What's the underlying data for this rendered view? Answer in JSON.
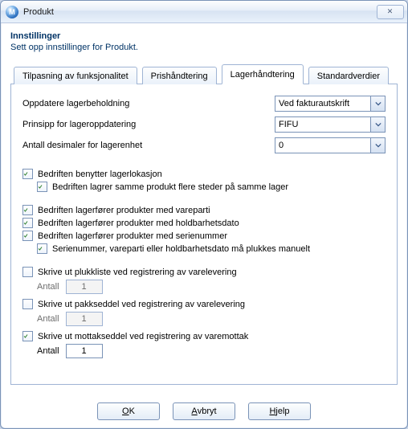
{
  "window": {
    "title": "Produkt",
    "app_icon_letter": "M",
    "close_glyph": "✕"
  },
  "header": {
    "title": "Innstillinger",
    "subtitle": "Sett opp innstillinger for Produkt."
  },
  "tabs": {
    "items": [
      {
        "label": "Tilpasning av funksjonalitet"
      },
      {
        "label": "Prishåndtering"
      },
      {
        "label": "Lagerhåndtering"
      },
      {
        "label": "Standardverdier"
      }
    ],
    "active_index": 2
  },
  "form": {
    "row1": {
      "label": "Oppdatere lagerbeholdning",
      "value": "Ved fakturautskrift"
    },
    "row2": {
      "label": "Prinsipp for lageroppdatering",
      "value": "FIFU"
    },
    "row3": {
      "label": "Antall desimaler for lagerenhet",
      "value": "0"
    }
  },
  "checks": {
    "c1": {
      "label": "Bedriften benytter lagerlokasjon"
    },
    "c1a": {
      "label": "Bedriften lagrer samme produkt flere steder på samme lager"
    },
    "c2": {
      "label": "Bedriften lagerfører produkter med vareparti"
    },
    "c3": {
      "label": "Bedriften lagerfører produkter med holdbarhetsdato"
    },
    "c4": {
      "label": "Bedriften lagerfører produkter med serienummer"
    },
    "c4a": {
      "label": "Serienummer, vareparti eller holdbarhetsdato må plukkes manuelt"
    },
    "p1": {
      "label": "Skrive ut plukkliste ved registrering av varelevering",
      "count_label": "Antall",
      "count": "1"
    },
    "p2": {
      "label": "Skrive ut pakkseddel ved registrering av varelevering",
      "count_label": "Antall",
      "count": "1"
    },
    "p3": {
      "label": "Skrive ut mottakseddel ved registrering av varemottak",
      "count_label": "Antall",
      "count": "1"
    }
  },
  "buttons": {
    "ok_pre": "",
    "ok_u": "O",
    "ok_post": "K",
    "cancel_pre": "",
    "cancel_u": "A",
    "cancel_post": "vbryt",
    "help_pre": "",
    "help_u": "H",
    "help_post": "jelp"
  }
}
